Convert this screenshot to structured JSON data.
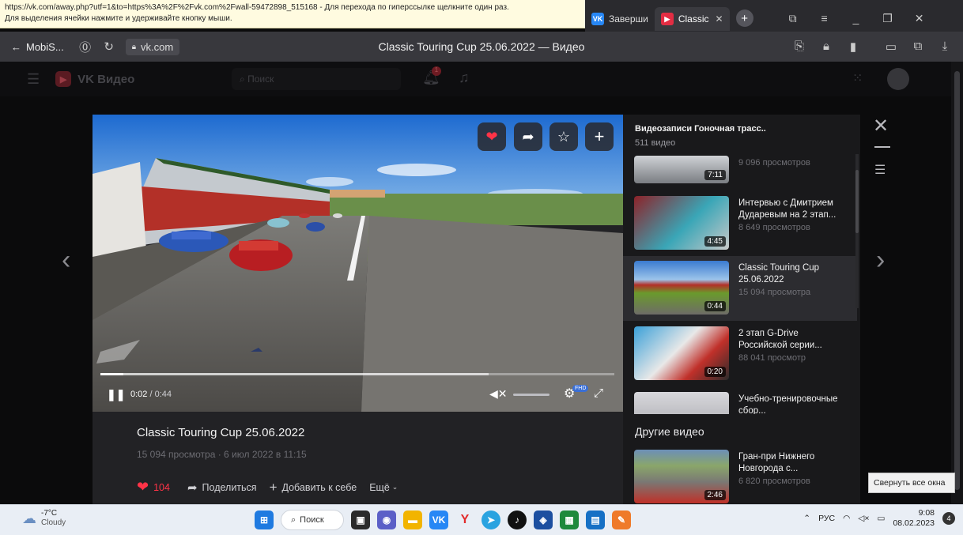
{
  "status_strip": {
    "line1": "https://vk.com/away.php?utf=1&to=https%3A%2F%2Fvk.com%2Fwall-59472898_515168 - Для перехода по гиперссылке щелкните один раз.",
    "line2": "Для выделения ячейки нажмите и удерживайте кнопку мыши."
  },
  "tabs": [
    {
      "label": "Заверши",
      "icon": "vk-icon",
      "color": "#2787f5"
    },
    {
      "label": "Classic",
      "icon": "vk-video-icon",
      "color": "#e32d43"
    }
  ],
  "address_bar": {
    "back_label": "MobiS...",
    "url": "vk.com",
    "page_title": "Classic Touring Cup 25.06.2022 — Видео"
  },
  "vk_header": {
    "brand": "VK Видео",
    "search_placeholder": "Поиск",
    "notif_count": "1"
  },
  "player": {
    "time_current": "0:02",
    "time_total": "0:44",
    "time_sep": " / ",
    "progress_played": 0.045,
    "progress_buffered": 0.755,
    "quality_badge": "FHD"
  },
  "video_info": {
    "title": "Classic Touring Cup 25.06.2022",
    "meta": "15 094 просмотра · 6 июл 2022 в 11:15",
    "likes": "104",
    "share": "Поделиться",
    "add": "Добавить к себе",
    "more": "Ещё"
  },
  "playlist": {
    "header": "Видеозаписи Гоночная трасс..",
    "count": "511 видео",
    "items": [
      {
        "title": "",
        "views": "9 096 просмотров",
        "duration": "7:11"
      },
      {
        "title": "Интервью с Дмитрием Дударевым на 2 этап...",
        "views": "8 649 просмотров",
        "duration": "4:45"
      },
      {
        "title": "Classic Touring Cup 25.06.2022",
        "views": "15 094 просмотра",
        "duration": "0:44"
      },
      {
        "title": "2 этап G-Drive Российской серии...",
        "views": "88 041 просмотр",
        "duration": "0:20"
      },
      {
        "title": "Учебно-тренировочные сбор...",
        "views": "",
        "duration": ""
      }
    ],
    "other_header": "Другие видео",
    "other_items": [
      {
        "title": "Гран-при Нижнего Новгорода с...",
        "views": "6 820 просмотров",
        "duration": "2:46"
      }
    ]
  },
  "tooltip": "Свернуть все окна",
  "taskbar": {
    "weather_temp": "-7°C",
    "weather_desc": "Cloudy",
    "search_label": "Поиск",
    "lang": "РУС",
    "time": "9:08",
    "date": "08.02.2023",
    "notif_badge": "4"
  }
}
